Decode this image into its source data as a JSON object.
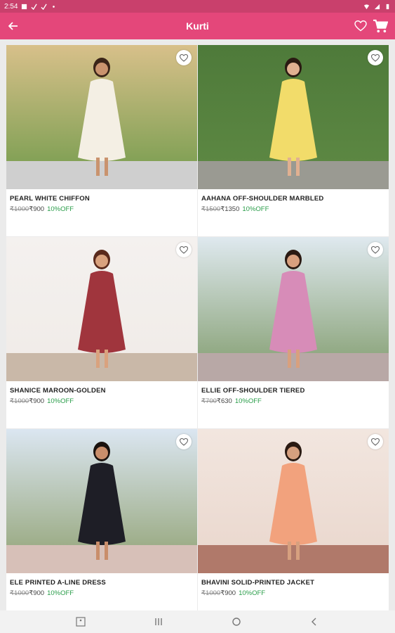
{
  "status_bar": {
    "time": "2:54"
  },
  "app_bar": {
    "title": "Kurti"
  },
  "products": [
    {
      "name": "PEARL WHITE CHIFFON",
      "mrp": "₹1000",
      "price": "₹900",
      "discount": "10%OFF",
      "bg_top": "#d8c08a",
      "bg_bottom": "#6f9a4a",
      "floor": "#cfcfcf",
      "dress": "#f4efe4",
      "skin": "#c9936e",
      "hair": "#3a2418"
    },
    {
      "name": "AAHANA OFF-SHOULDER MARBLED",
      "mrp": "₹1500",
      "price": "₹1350",
      "discount": "10%OFF",
      "bg_top": "#4e7a3a",
      "bg_bottom": "#5f8a44",
      "floor": "#9a9a92",
      "dress": "#f2dc6a",
      "skin": "#e0b091",
      "hair": "#2a1a12"
    },
    {
      "name": "SHANICE MAROON-GOLDEN",
      "mrp": "₹1000",
      "price": "₹900",
      "discount": "10%OFF",
      "bg_top": "#f4f1ef",
      "bg_bottom": "#f0ebe7",
      "floor": "#c9b8a8",
      "dress": "#a0353d",
      "skin": "#d9a27e",
      "hair": "#5a2a1c"
    },
    {
      "name": "ELLIE OFF-SHOULDER TIERED",
      "mrp": "₹700",
      "price": "₹630",
      "discount": "10%OFF",
      "bg_top": "#dfe9ef",
      "bg_bottom": "#7f9a6a",
      "floor": "#b8a8a6",
      "dress": "#d78cb8",
      "skin": "#d8a07e",
      "hair": "#2a1a12"
    },
    {
      "name": "ELE PRINTED A-LINE DRESS",
      "mrp": "₹1000",
      "price": "₹900",
      "discount": "10%OFF",
      "bg_top": "#dbe6f1",
      "bg_bottom": "#8fa070",
      "floor": "#d7c0b8",
      "dress": "#1e1e26",
      "skin": "#c98e6b",
      "hair": "#1a120e"
    },
    {
      "name": "BHAVINI SOLID-PRINTED JACKET",
      "mrp": "₹1000",
      "price": "₹900",
      "discount": "10%OFF",
      "bg_top": "#f2e6df",
      "bg_bottom": "#e9d6cc",
      "floor": "#b0796a",
      "dress": "#f2a27d",
      "skin": "#d6a07f",
      "hair": "#2a1a12"
    }
  ],
  "colors": {
    "accent": "#e4477a",
    "status_bar": "#c9406c",
    "discount": "#2a9d4a"
  }
}
